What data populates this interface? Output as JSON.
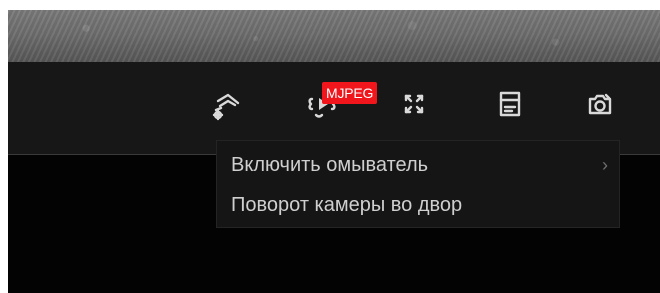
{
  "toolbar": {
    "stream_badge": "MJPEG",
    "icons": {
      "washer": "washer-icon",
      "stream": "stream-switch-icon",
      "fullscreen": "fullscreen-icon",
      "archive": "archive-icon",
      "snapshot": "camera-snapshot-icon"
    }
  },
  "menu": {
    "items": [
      {
        "label": "Включить омыватель"
      },
      {
        "label": "Поворот камеры во двор"
      }
    ]
  },
  "colors": {
    "badge": "#f0161b",
    "toolbar": "#171717",
    "menu": "#151515",
    "text": "#cfcfcf"
  }
}
